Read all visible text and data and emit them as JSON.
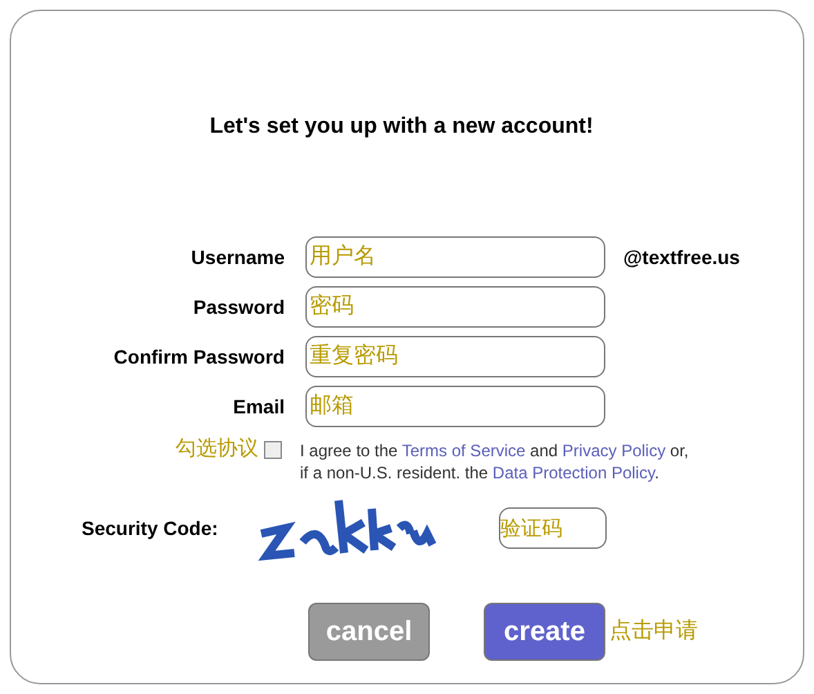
{
  "title": "Let's set you up with a new account!",
  "fields": [
    {
      "label": "Username",
      "placeholder": "用户名",
      "suffix": "@textfree.us"
    },
    {
      "label": "Password",
      "placeholder": "密码"
    },
    {
      "label": "Confirm Password",
      "placeholder": "重复密码"
    },
    {
      "label": "Email",
      "placeholder": "邮箱"
    }
  ],
  "agreement": {
    "note": "勾选协议",
    "checked": false,
    "lines": [
      [
        {
          "kind": "text",
          "text": "I agree to the "
        },
        {
          "kind": "link",
          "text": "Terms of Service"
        },
        {
          "kind": "text",
          "text": " and "
        },
        {
          "kind": "link",
          "text": "Privacy Policy"
        },
        {
          "kind": "text",
          "text": " or,"
        }
      ],
      [
        {
          "kind": "text",
          "text": "if a non-U.S. resident. the "
        },
        {
          "kind": "link",
          "text": "Data Protection Policy"
        },
        {
          "kind": "text",
          "text": "."
        }
      ]
    ]
  },
  "security": {
    "label": "Security Code:",
    "placeholder": "验证码"
  },
  "buttons": [
    {
      "label": "cancel",
      "kind": "secondary"
    },
    {
      "label": "create",
      "kind": "primary"
    }
  ],
  "create_note": "点击申请"
}
